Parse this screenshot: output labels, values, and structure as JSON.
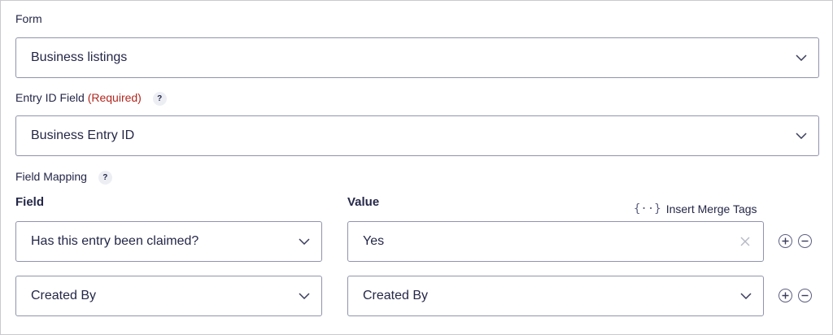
{
  "form": {
    "label": "Form",
    "selected": "Business listings"
  },
  "entry_id": {
    "label": "Entry ID Field",
    "required": "(Required)",
    "help": "?",
    "selected": "Business Entry ID"
  },
  "field_mapping": {
    "label": "Field Mapping",
    "help": "?",
    "field_header": "Field",
    "value_header": "Value",
    "merge_tags_label": "Insert Merge Tags",
    "merge_tags_icon": "{··}",
    "rows": [
      {
        "field": "Has this entry been claimed?",
        "value": "Yes",
        "value_type": "input"
      },
      {
        "field": "Created By",
        "value": "Created By",
        "value_type": "select"
      }
    ]
  },
  "icons": {
    "chevron": "chevron-down-icon",
    "clear": "close-icon",
    "add": "plus-circle-icon",
    "remove": "minus-circle-icon"
  }
}
